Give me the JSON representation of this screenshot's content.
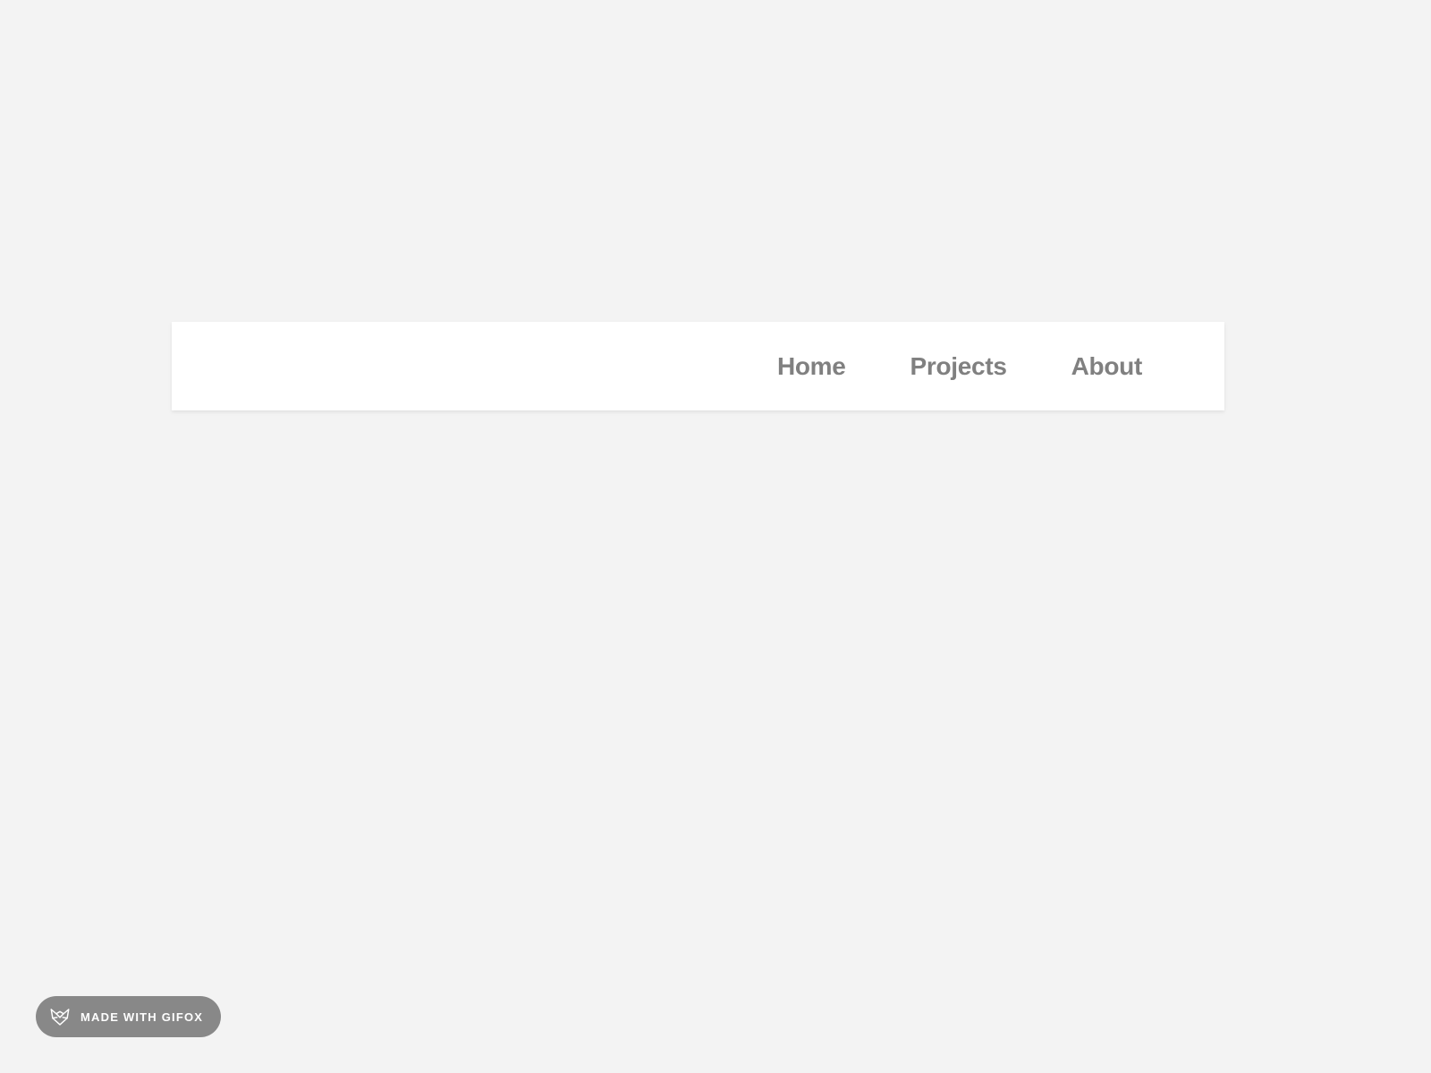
{
  "nav": {
    "items": [
      {
        "label": "Home"
      },
      {
        "label": "Projects"
      },
      {
        "label": "About"
      }
    ]
  },
  "badge": {
    "text": "MADE WITH GIFOX"
  }
}
